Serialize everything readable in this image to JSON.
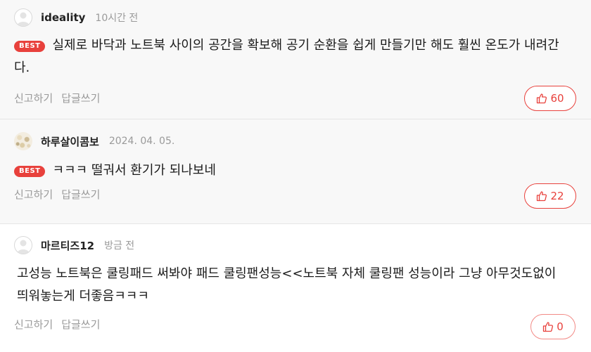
{
  "comments": [
    {
      "nickname": "ideality",
      "time": "10시간 전",
      "badge": "BEST",
      "text": "실제로 바닥과 노트북 사이의 공간을 확보해 공기 순환을 쉽게 만들기만 해도 훨씬 온도가 내려간다.",
      "report_label": "신고하기",
      "reply_label": "답글쓰기",
      "likes": "60"
    },
    {
      "nickname": "하루살이콤보",
      "time": "2024. 04. 05.",
      "badge": "BEST",
      "text": "ㅋㅋㅋ 떨궈서 환기가 되나보네",
      "report_label": "신고하기",
      "reply_label": "답글쓰기",
      "likes": "22"
    },
    {
      "nickname": "마르티즈12",
      "time": "방금 전",
      "text": "고성능 노트북은 쿨링패드 써봐야 패드 쿨링팬성능<<노트북 자체 쿨링팬 성능이라 그냥 아무것도없이 띄워놓는게 더좋음ㅋㅋㅋ",
      "report_label": "신고하기",
      "reply_label": "답글쓰기",
      "likes": "0"
    }
  ],
  "icons": {
    "avatar_default": "person-silhouette",
    "like": "thumbs-up-outline"
  },
  "colors": {
    "accent": "#e8413c",
    "best_background": "#f8f8f8",
    "muted_text": "#9a9a9a"
  }
}
